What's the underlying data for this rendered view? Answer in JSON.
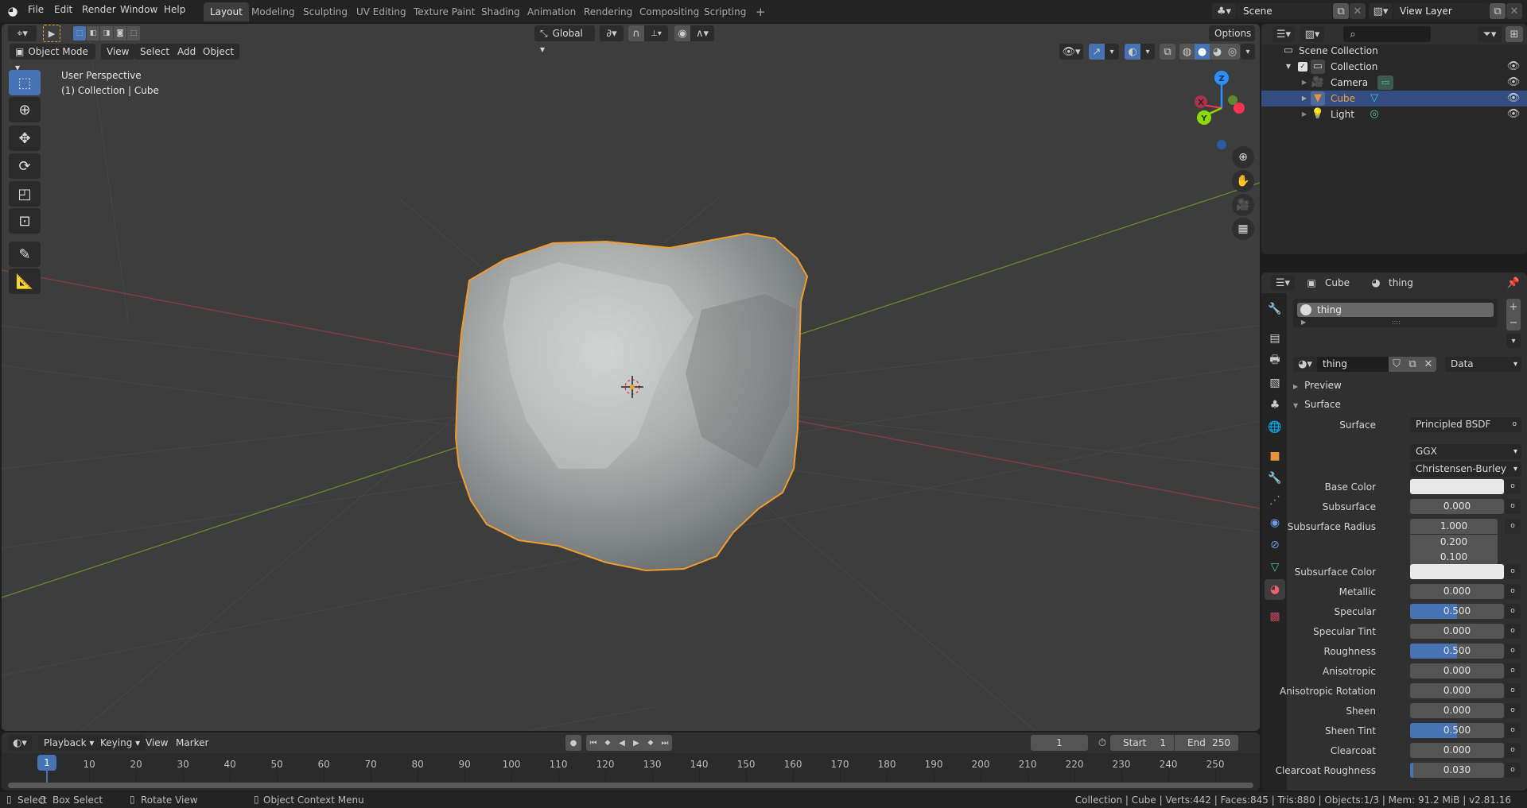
{
  "topbar": {
    "logo_icon": "blender-logo-icon",
    "menus": [
      "File",
      "Edit",
      "Render",
      "Window",
      "Help"
    ],
    "workspaces": [
      "Layout",
      "Modeling",
      "Sculpting",
      "UV Editing",
      "Texture Paint",
      "Shading",
      "Animation",
      "Rendering",
      "Compositing",
      "Scripting"
    ],
    "active_workspace": "Layout",
    "add_workspace": "+",
    "scene": "Scene",
    "view_layer": "View Layer"
  },
  "viewport": {
    "mode": "Object Mode",
    "menus": [
      "View",
      "Select",
      "Add",
      "Object"
    ],
    "transform_orientation": "Global",
    "options_label": "Options",
    "overlay_text_line1": "User Perspective",
    "overlay_text_line2": "(1) Collection | Cube",
    "gizmo_axes": {
      "x": "X",
      "y": "Y",
      "z": "Z"
    },
    "colors": {
      "selection_outline": "#f19b2c",
      "x_axis": "#ff3352",
      "y_axis": "#8bdc00",
      "z_axis": "#2890ff",
      "active_tool": "#4772b3"
    }
  },
  "outliner": {
    "root": "Scene Collection",
    "items": [
      {
        "label": "Collection",
        "type": "collection",
        "checked": true
      },
      {
        "label": "Camera",
        "type": "camera",
        "selected": false
      },
      {
        "label": "Cube",
        "type": "mesh",
        "selected": true
      },
      {
        "label": "Light",
        "type": "light",
        "selected": false
      }
    ]
  },
  "properties": {
    "breadcrumb_object": "Cube",
    "breadcrumb_material": "thing",
    "slot_name": "thing",
    "material_name": "thing",
    "link_mode": "Data",
    "sections": {
      "preview": "Preview",
      "surface": "Surface"
    },
    "surface_label": "Surface",
    "surface_shader": "Principled BSDF",
    "distribution": "GGX",
    "subsurface_method": "Christensen-Burley",
    "fields": [
      {
        "label": "Base Color",
        "type": "color",
        "value": "#e8e8e8"
      },
      {
        "label": "Subsurface",
        "value": "0.000",
        "fill": 0
      },
      {
        "label": "Subsurface Radius",
        "values": [
          "1.000",
          "0.200",
          "0.100"
        ]
      },
      {
        "label": "Subsurface Color",
        "type": "color",
        "value": "#e8e8e8"
      },
      {
        "label": "Metallic",
        "value": "0.000",
        "fill": 0
      },
      {
        "label": "Specular",
        "value": "0.500",
        "fill": 0.5
      },
      {
        "label": "Specular Tint",
        "value": "0.000",
        "fill": 0
      },
      {
        "label": "Roughness",
        "value": "0.500",
        "fill": 0.5
      },
      {
        "label": "Anisotropic",
        "value": "0.000",
        "fill": 0
      },
      {
        "label": "Anisotropic Rotation",
        "value": "0.000",
        "fill": 0
      },
      {
        "label": "Sheen",
        "value": "0.000",
        "fill": 0
      },
      {
        "label": "Sheen Tint",
        "value": "0.500",
        "fill": 0.5
      },
      {
        "label": "Clearcoat",
        "value": "0.000",
        "fill": 0
      },
      {
        "label": "Clearcoat Roughness",
        "value": "0.030",
        "fill": 0.03
      }
    ]
  },
  "timeline": {
    "menus": [
      "Playback",
      "Keying",
      "View",
      "Marker"
    ],
    "current_frame": "1",
    "start_label": "Start",
    "start": "1",
    "end_label": "End",
    "end": "250",
    "ticks": [
      "10",
      "20",
      "30",
      "40",
      "50",
      "60",
      "70",
      "80",
      "90",
      "100",
      "110",
      "120",
      "130",
      "140",
      "150",
      "160",
      "170",
      "180",
      "190",
      "200",
      "210",
      "220",
      "230",
      "240",
      "250"
    ]
  },
  "statusbar": {
    "select": "Select",
    "box_select": "Box Select",
    "rotate_view": "Rotate View",
    "context_menu": "Object Context Menu",
    "stats": "Collection | Cube | Verts:442 | Faces:845 | Tris:880 | Objects:1/3 | Mem: 91.2 MiB | v2.81.16"
  }
}
